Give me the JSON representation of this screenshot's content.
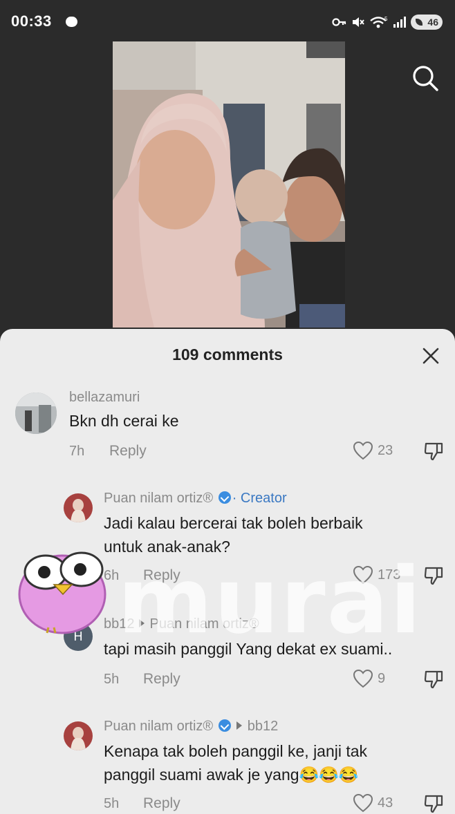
{
  "status_bar": {
    "time": "00:33",
    "battery": "46"
  },
  "icons": {
    "search": "search-icon",
    "close": "close-icon",
    "like": "heart-icon",
    "dislike": "thumbs-down-icon",
    "verified": "verified-badge-icon"
  },
  "colors": {
    "accent_creator": "#3a78c2",
    "sheet_bg": "#ececec",
    "background": "#2b2b2b"
  },
  "comments_header": {
    "title": "109 comments"
  },
  "comments": [
    {
      "username": "bellazamuri",
      "text": "Bkn dh cerai ke",
      "time": "7h",
      "reply_label": "Reply",
      "likes": "23"
    },
    {
      "username": "Puan nilam ortiz®",
      "badge": "· Creator",
      "text_line1": "Jadi kalau bercerai tak boleh berbaik",
      "text_line2": "untuk anak-anak?",
      "time": "6h",
      "reply_label": "Reply",
      "likes": "173"
    },
    {
      "username": "bb12",
      "reply_to": "Puan nilam ortiz®",
      "avatar_letter": "H",
      "text": "tapi masih panggil Yang dekat ex suami..",
      "time": "5h",
      "reply_label": "Reply",
      "likes": "9"
    },
    {
      "username": "Puan nilam ortiz®",
      "reply_to": "bb12",
      "text_line1": "Kenapa tak boleh panggil ke, janji tak",
      "text_line2": "panggil suami awak je yang😂😂😂",
      "time": "5h",
      "reply_label": "Reply",
      "likes": "43"
    }
  ],
  "watermark": {
    "text": "murai"
  }
}
